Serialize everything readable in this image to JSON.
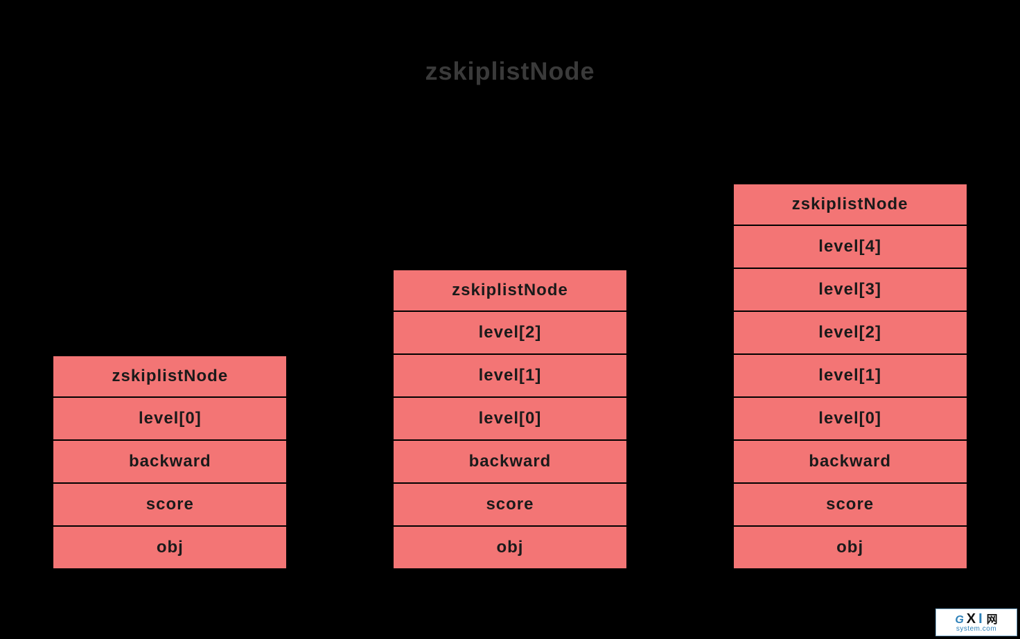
{
  "title": "zskiplistNode",
  "nodes": [
    {
      "header": "zskiplistNode",
      "rows": [
        "level[0]",
        "backward",
        "score",
        "obj"
      ]
    },
    {
      "header": "zskiplistNode",
      "rows": [
        "level[2]",
        "level[1]",
        "level[0]",
        "backward",
        "score",
        "obj"
      ]
    },
    {
      "header": "zskiplistNode",
      "rows": [
        "level[4]",
        "level[3]",
        "level[2]",
        "level[1]",
        "level[0]",
        "backward",
        "score",
        "obj"
      ]
    }
  ],
  "watermark": {
    "g": "G",
    "x": "X",
    "i": "I",
    "cn": "网",
    "sub": "system.com"
  }
}
